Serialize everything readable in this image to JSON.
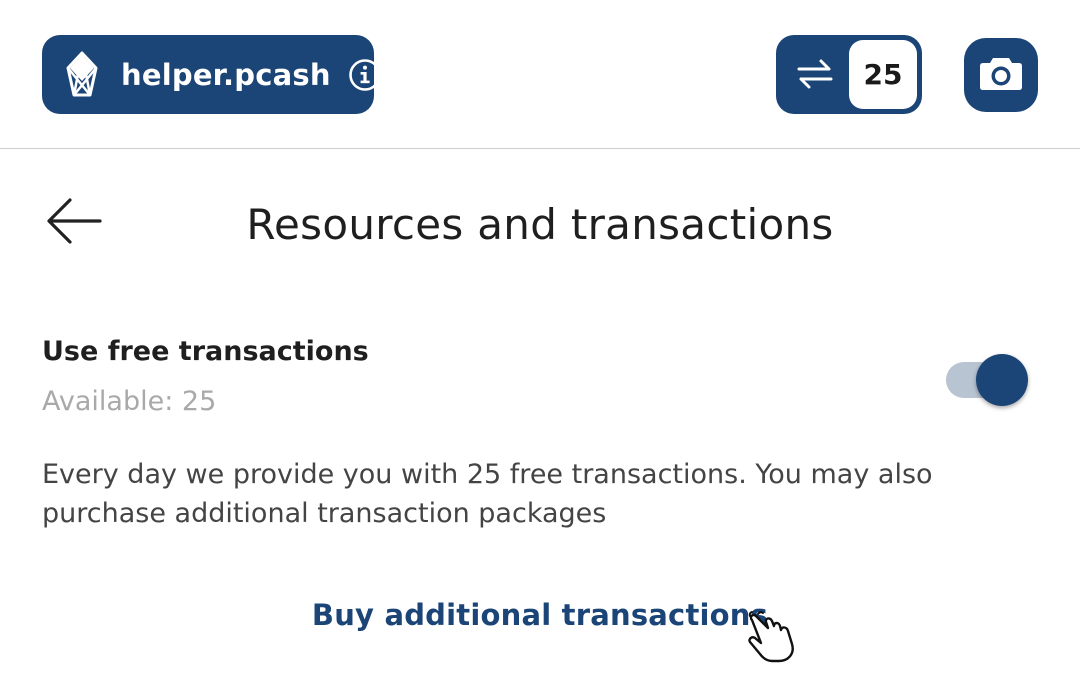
{
  "header": {
    "account_name": "helper.pcash",
    "transactions_count": "25"
  },
  "page": {
    "title": "Resources and transactions"
  },
  "free_transactions": {
    "label": "Use free transactions",
    "available": "Available: 25",
    "enabled": true,
    "description": "Every day we provide you with 25 free transactions. You may also purchase additional transaction packages"
  },
  "actions": {
    "buy_label": "Buy additional transactions"
  },
  "colors": {
    "brand": "#1b4477",
    "toggle_track": "#b9c4d2",
    "muted_text": "#a9a9a9"
  },
  "icons": {
    "logo": "eos-logo-icon",
    "info": "info-icon",
    "swap": "swap-arrows-icon",
    "camera": "camera-icon",
    "back": "arrow-left-icon",
    "cursor": "hand-pointer-icon"
  }
}
